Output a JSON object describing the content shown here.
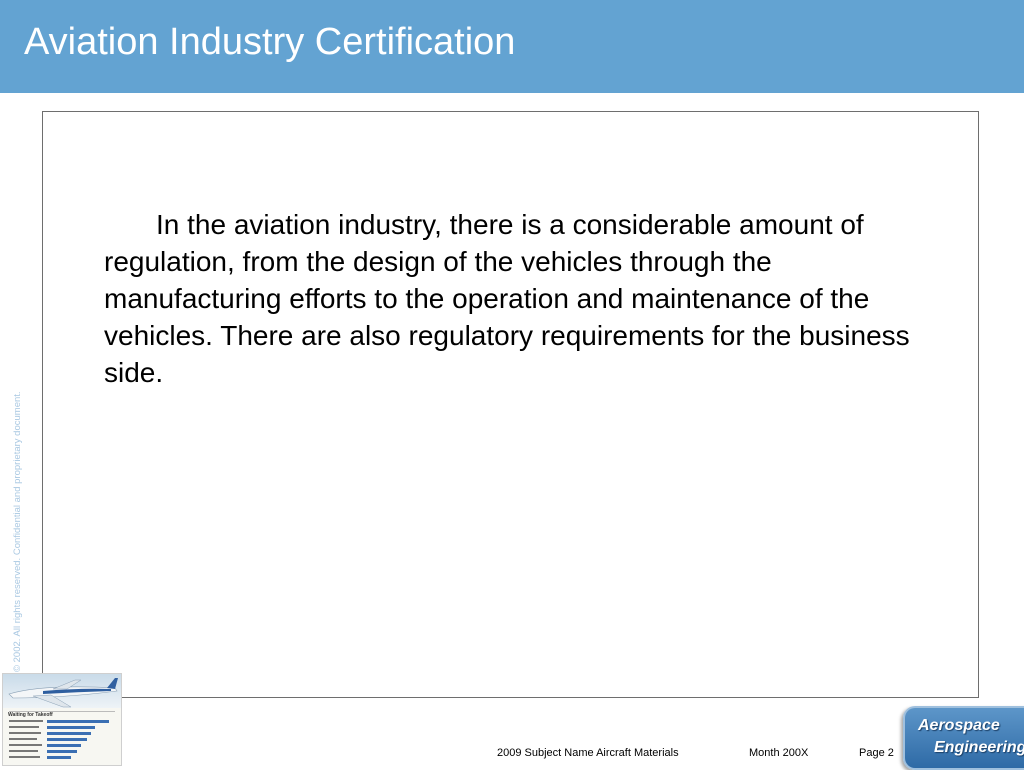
{
  "slide": {
    "title": "Aviation Industry Certification",
    "body": "In the aviation industry, there is a considerable amount of regulation, from the design of the vehicles through the manufacturing efforts to the operation and maintenance of the vehicles. There are also regulatory requirements for the business side."
  },
  "sidebar": {
    "copyright": "© 2002. All rights reserved. Confidential and proprietary document."
  },
  "thumbnail": {
    "heading": "Waiting for Takeoff"
  },
  "footer": {
    "course": "2009 Subject Name  Aircraft Materials",
    "date": "Month 200X",
    "page": "Page 2"
  },
  "logo": {
    "line1": "Aerospace",
    "line2": "Engineering"
  },
  "colors": {
    "title_bar": "#63a3d2",
    "logo_fill": "#2e6aa6",
    "chart_bars": "#3b6fb3"
  }
}
